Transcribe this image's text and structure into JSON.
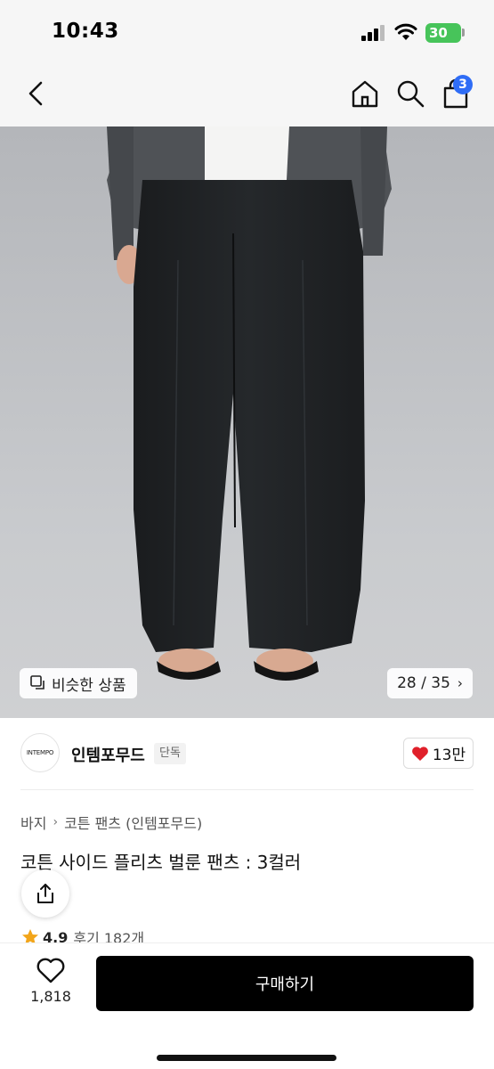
{
  "status_bar": {
    "time": "10:43",
    "battery": "30"
  },
  "nav": {
    "cart_count": "3"
  },
  "gallery": {
    "similar_label": "비슷한 상품",
    "counter": "28 / 35"
  },
  "brand": {
    "logo_text": "INTEMPO",
    "name": "인템포무드",
    "badge": "단독",
    "likes": "13만"
  },
  "breadcrumb": {
    "items": [
      "바지",
      "코튼 팬츠 (인템포무드)"
    ]
  },
  "product": {
    "title": "코튼 사이드 플리츠 벌룬 팬츠 : 3컬러"
  },
  "rating": {
    "score": "4.9",
    "reviews": "후기 182개"
  },
  "bottom": {
    "wish_count": "1,818",
    "buy_label": "구매하기"
  },
  "icons": [
    "back-icon",
    "home-icon",
    "search-icon",
    "shopping-bag-icon",
    "similar-items-icon",
    "heart-icon",
    "share-icon",
    "star-icon"
  ],
  "colors": {
    "cart_badge": "#2f6df6",
    "buy_button": "#000000",
    "heart": "#e0202a",
    "star": "#f2a51a"
  }
}
